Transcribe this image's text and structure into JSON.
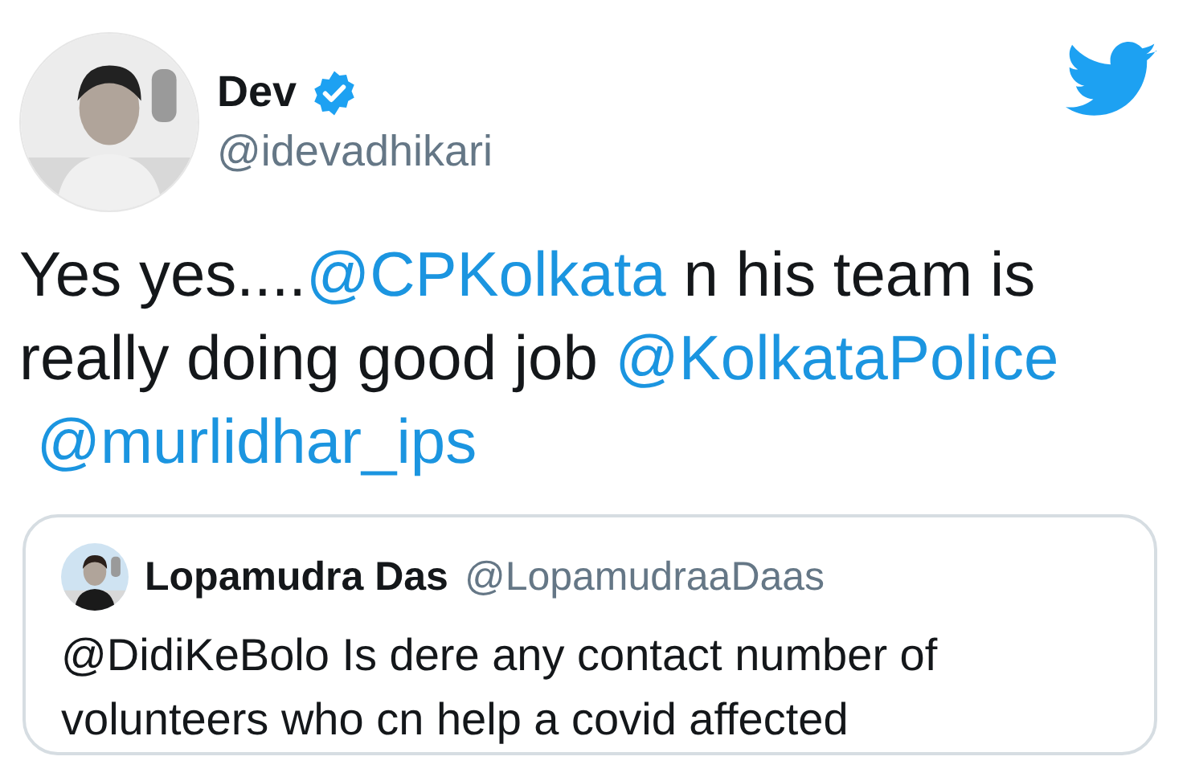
{
  "author": {
    "name": "Dev",
    "verified": true,
    "handle": "@idevadhikari"
  },
  "text": [
    {
      "kind": "plain",
      "text": "Yes yes...."
    },
    {
      "kind": "mention",
      "text": "@CPKolkata"
    },
    {
      "kind": "plain",
      "text": " n his team is really doing good job "
    },
    {
      "kind": "mention",
      "text": "@KolkataPolice"
    },
    {
      "kind": "mention",
      "text": "@murlidhar_ips"
    }
  ],
  "quoted": {
    "name": "Lopamudra Das",
    "handle": "@LopamudraaDaas",
    "text": "@DidiKeBolo Is dere any contact number of volunteers who cn help a covid affected"
  }
}
